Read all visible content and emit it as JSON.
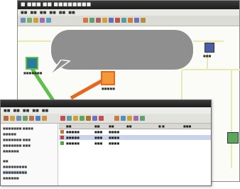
{
  "back_window": {
    "title": "■ ■■■ ■■ ■■■■■■■■",
    "menu": [
      "■■",
      "■■",
      "■■",
      "■■",
      "■■",
      "■■"
    ]
  },
  "front_window": {
    "menu": [
      "■■",
      "■■",
      "■■",
      "■■",
      "■■"
    ],
    "columns": [
      "■■",
      "■■",
      "■■",
      "■■",
      "■ ■",
      "■■■"
    ],
    "rows": [
      {
        "name": "■■■■■",
        "type": "■■■",
        "status": "■■■■"
      },
      {
        "name": "■■■■■",
        "type": "■■■",
        "status": "■■■■"
      },
      {
        "name": "■■■■■",
        "type": "■■■",
        "status": "■■■■"
      }
    ],
    "tree": [
      "■■■■■■■ ■■■■",
      "■■■■■",
      "■■■■■■■ ■■■",
      "■■■■■■■ ■■■",
      "■■■■■■",
      "■■",
      "■■■■■■■■■",
      "■■■■■■■■■",
      "■■■■■■"
    ]
  },
  "nodes": {
    "green_label": "■■■■■■■",
    "orange_label": "■■■■■",
    "blue_label": "■■■"
  },
  "colors": {
    "link_green": "#5cc04a",
    "link_orange": "#e8661c",
    "highlight_row": "#c9d3ec"
  }
}
